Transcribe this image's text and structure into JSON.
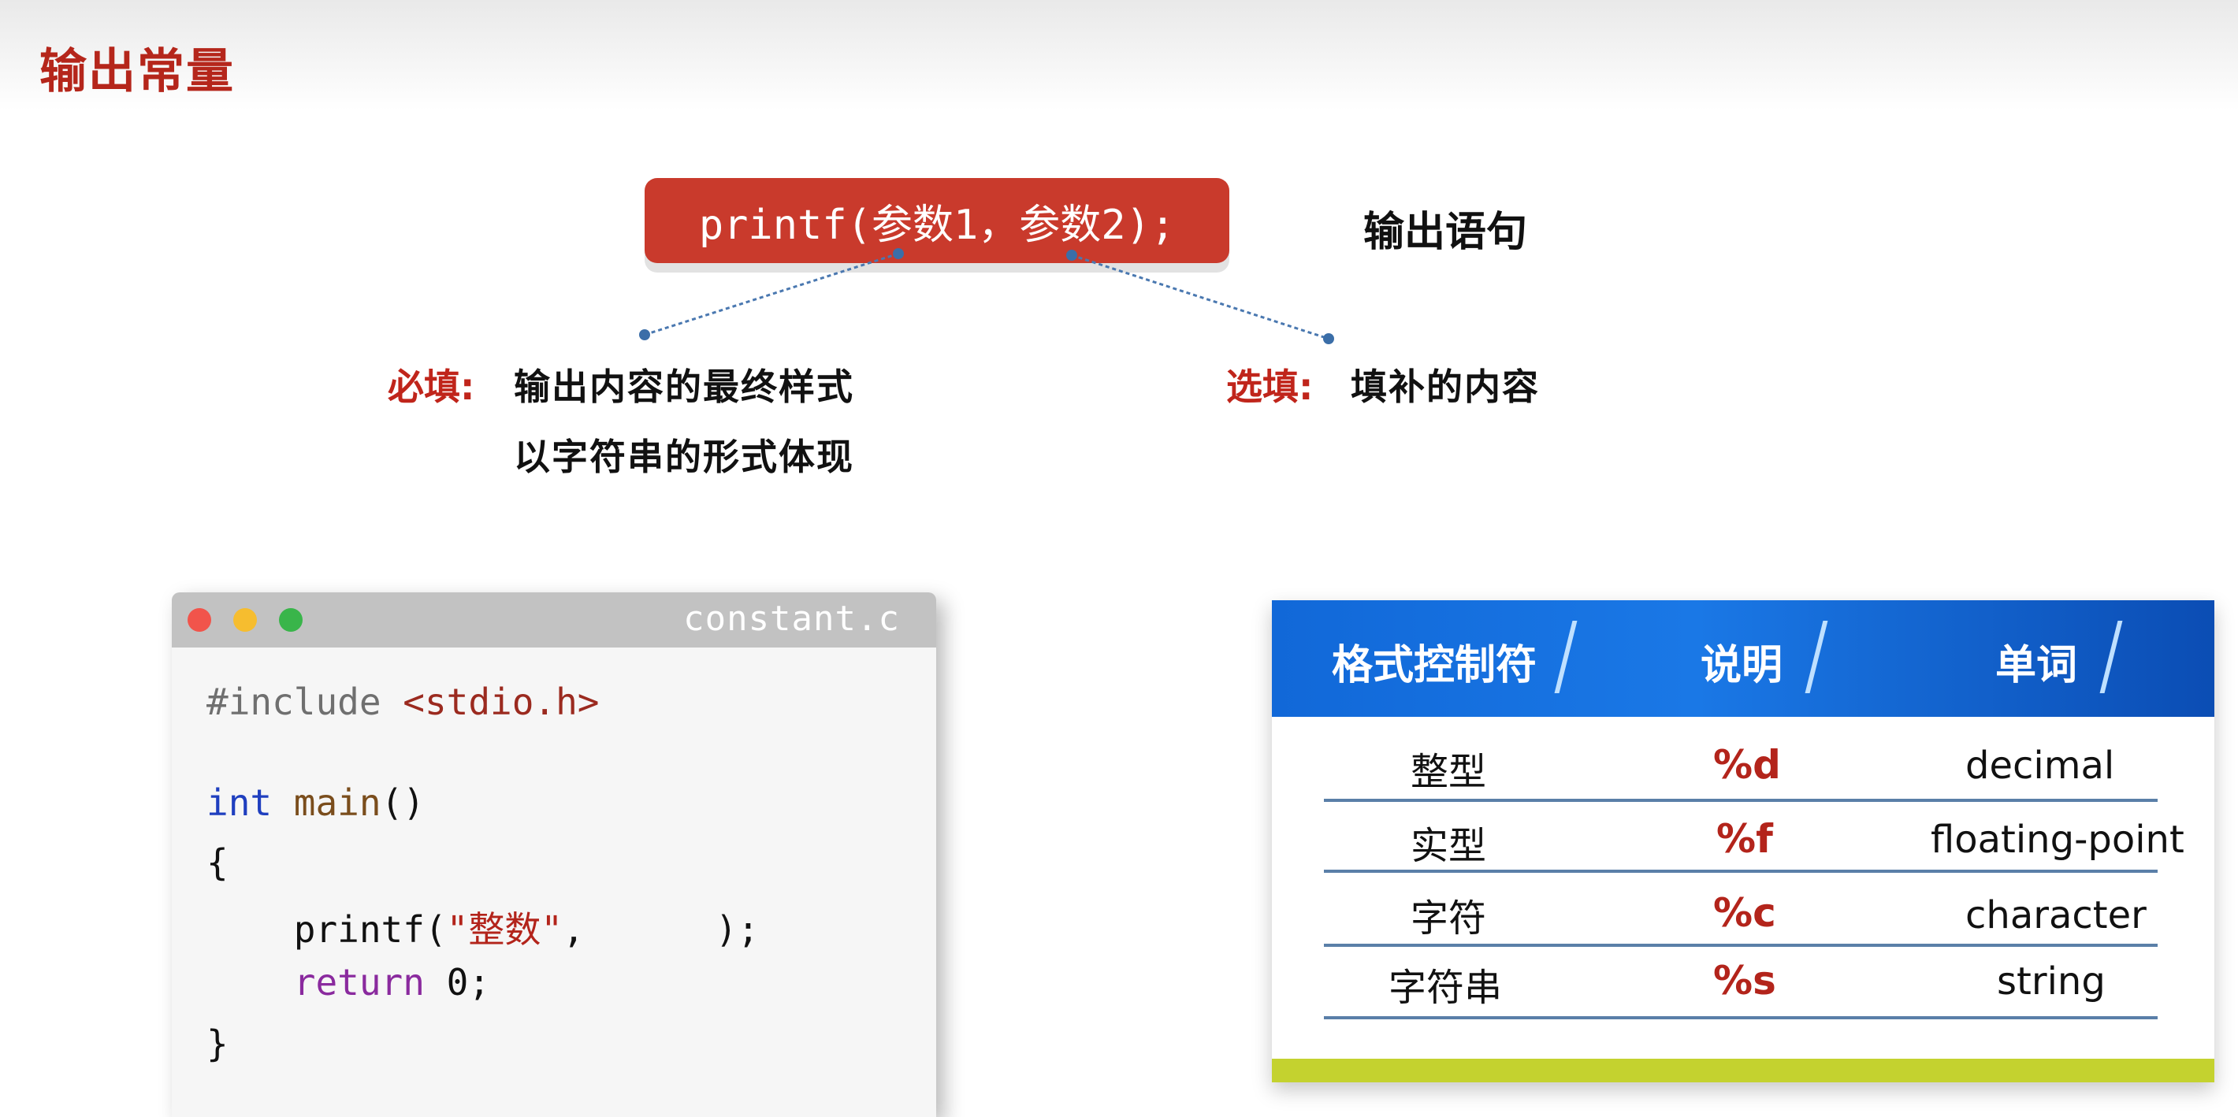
{
  "slide": {
    "title": "输出常量"
  },
  "syntax": {
    "printf_text": "printf(参数1，参数2);",
    "statement_label": "输出语句",
    "required_label": "必填:",
    "required_line1": "输出内容的最终样式",
    "required_line2": "以字符串的形式体现",
    "optional_label": "选填:",
    "optional_text": "填补的内容"
  },
  "code_window": {
    "filename": "constant.c",
    "lines": {
      "l1_pre": "#include ",
      "l1_hdr": "<stdio.h>",
      "l3_type": "int",
      "l3_sp": " ",
      "l3_func": "main",
      "l3_rest": "()",
      "l4": "{",
      "l5_a": "    printf(",
      "l5_str": "\"整数\"",
      "l5_b": ",      );",
      "l6_kw": "    return",
      "l6_rest": " 0;",
      "l7": "}"
    }
  },
  "format_table": {
    "headers": [
      "格式控制符",
      "说明",
      "单词"
    ],
    "rows": [
      {
        "name": "整型",
        "spec": "%d",
        "word": "decimal"
      },
      {
        "name": "实型",
        "spec": "%f",
        "word": "floating-point"
      },
      {
        "name": "字符",
        "spec": "%c",
        "word": "character"
      },
      {
        "name": "字符串",
        "spec": "%s",
        "word": "string"
      }
    ]
  },
  "colors": {
    "title_red": "#b5261b",
    "pill_red": "#c93a2c",
    "header_blue": "#1a78e6",
    "footer_green": "#c4d22f"
  }
}
